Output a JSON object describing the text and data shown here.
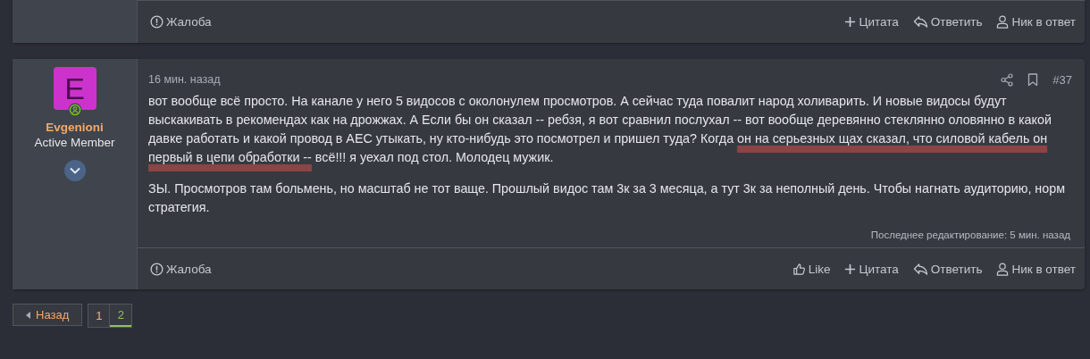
{
  "previous_post_footer": {
    "actions": [
      {
        "kind": "report",
        "label": "Жалоба"
      },
      {
        "kind": "quote",
        "label": "Цитата"
      },
      {
        "kind": "reply",
        "label": "Ответить"
      },
      {
        "kind": "mention",
        "label": "Ник в ответ"
      }
    ]
  },
  "post": {
    "author": {
      "initial": "E",
      "color": "#cc33cc",
      "online": true,
      "name": "Evgenioni",
      "role": "Active Member"
    },
    "time": "16 мин. назад",
    "number": "#37",
    "paragraphs": [
      [
        {
          "text": "вот вообще всё просто. На канале у него 5 видосов с околонулем просмотров. А сейчас туда повалит народ холиварить. И новые видосы будут выскакивать в рекомендах как на дрожжах. А Если бы он сказал -- ребзя, я вот сравнил послухал -- вот вообще деревянно стеклянно оловянно в какой давке работать и какой провод в АЕС утыкать, ну кто-нибудь это посмотрел и пришел туда? Когда ",
          "marked": false
        },
        {
          "text": "он на серьезных щах сказал, что силовой кабель он первый в цепи обработки --",
          "marked": true
        },
        {
          "text": " всё!!! я уехал под стол. Молодец мужик.",
          "marked": false
        }
      ],
      [
        {
          "text": "ЗЫ. Просмотров там больмень, но масштаб не тот ваще. Прошлый видос там 3к за 3 месяца, а тут 3к за неполный день. Чтобы нагнать аудиторию, норм стратегия.",
          "marked": false
        }
      ]
    ],
    "edited": "Последнее редактирование: 5 мин. назад",
    "actions": [
      {
        "kind": "report",
        "label": "Жалоба"
      },
      {
        "kind": "like",
        "label": "Like"
      },
      {
        "kind": "quote",
        "label": "Цитата"
      },
      {
        "kind": "reply",
        "label": "Ответить"
      },
      {
        "kind": "mention",
        "label": "Ник в ответ"
      }
    ]
  },
  "pagination": {
    "previous": "Назад",
    "pages": [
      {
        "label": "1",
        "selected": false
      },
      {
        "label": "2",
        "selected": true
      }
    ]
  }
}
